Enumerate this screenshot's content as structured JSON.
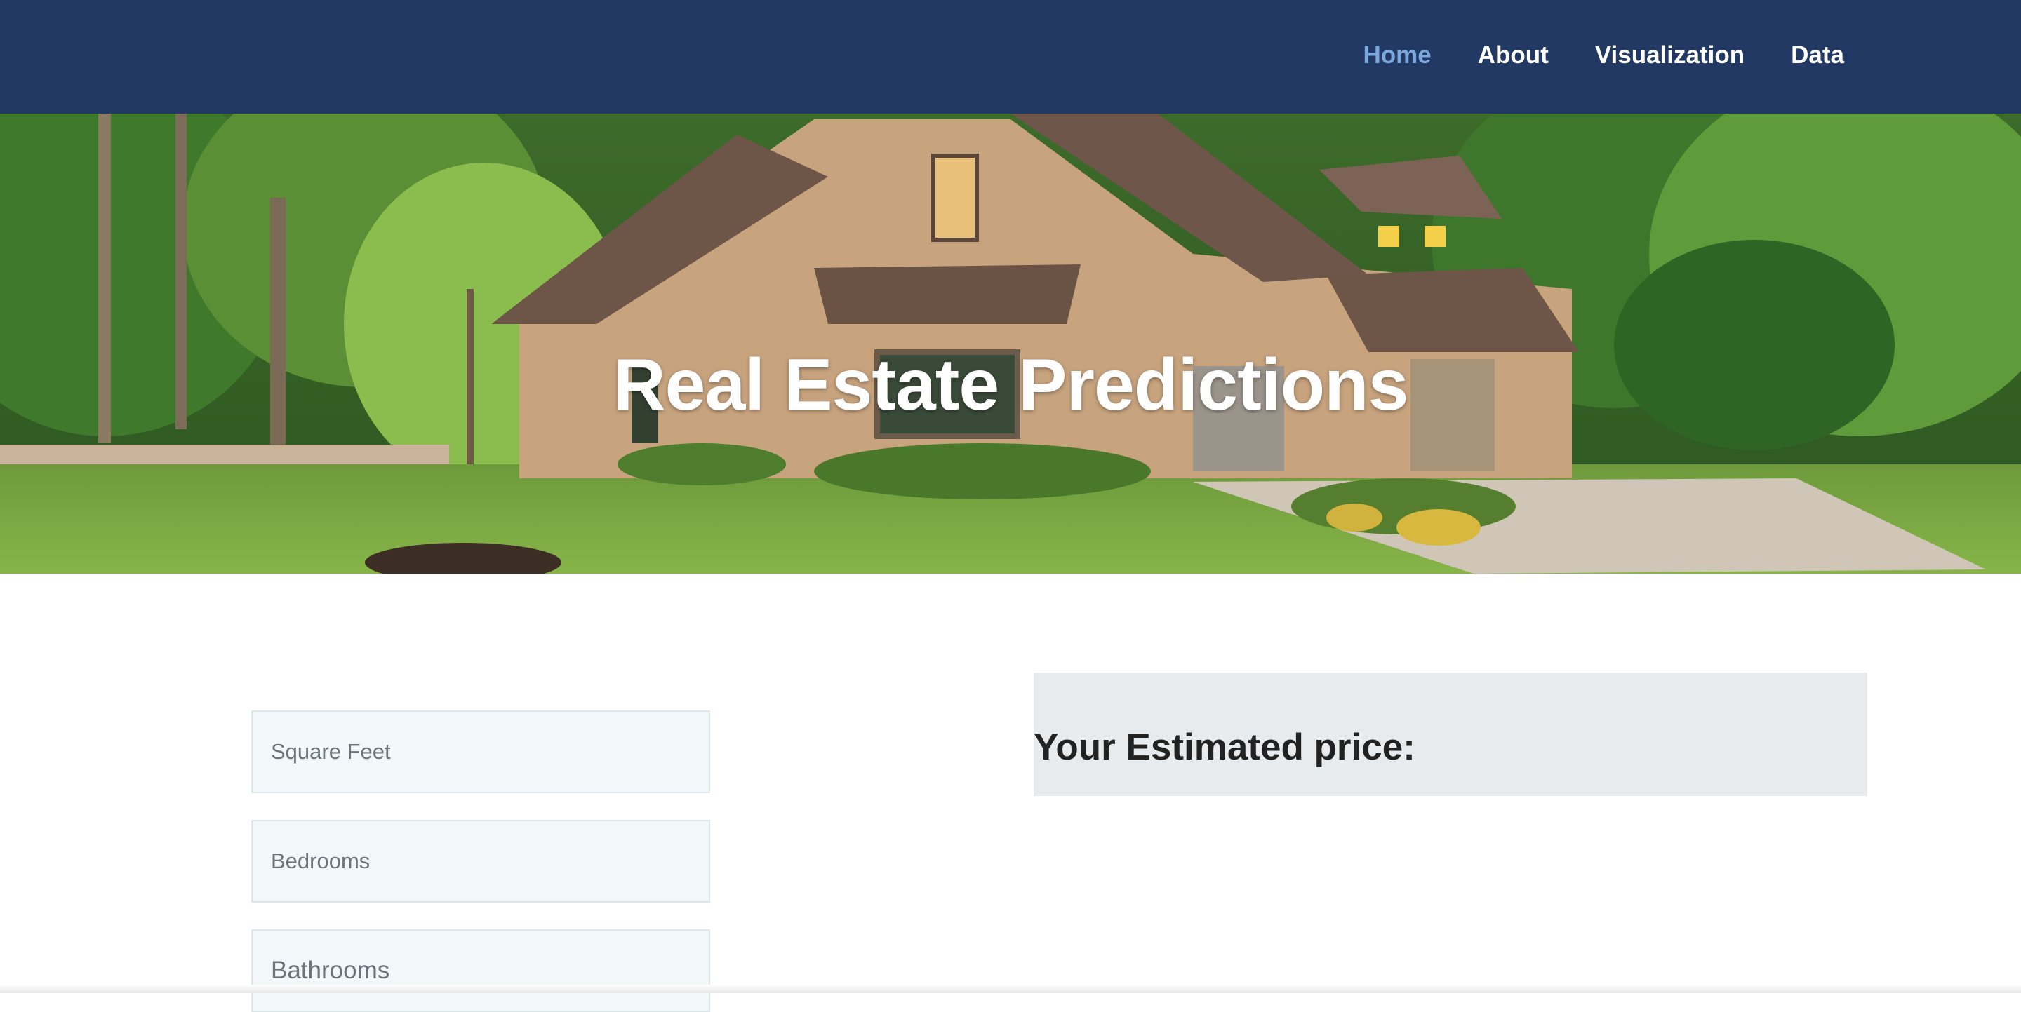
{
  "nav": {
    "items": [
      {
        "label": "Home",
        "active": true
      },
      {
        "label": "About",
        "active": false
      },
      {
        "label": "Visualization",
        "active": false
      },
      {
        "label": "Data",
        "active": false
      }
    ]
  },
  "hero": {
    "title": "Real Estate Predictions"
  },
  "form": {
    "square_feet_placeholder": "Square Feet",
    "bedrooms_placeholder": "Bedrooms",
    "bathrooms_placeholder": "Bathrooms"
  },
  "result": {
    "title": "Your Estimated price:"
  },
  "colors": {
    "navbar": "#213963",
    "nav_active": "#7ca9dd",
    "nav_text": "#ffffff",
    "input_bg": "#f2f7f9",
    "result_bg": "#e8ebed"
  }
}
